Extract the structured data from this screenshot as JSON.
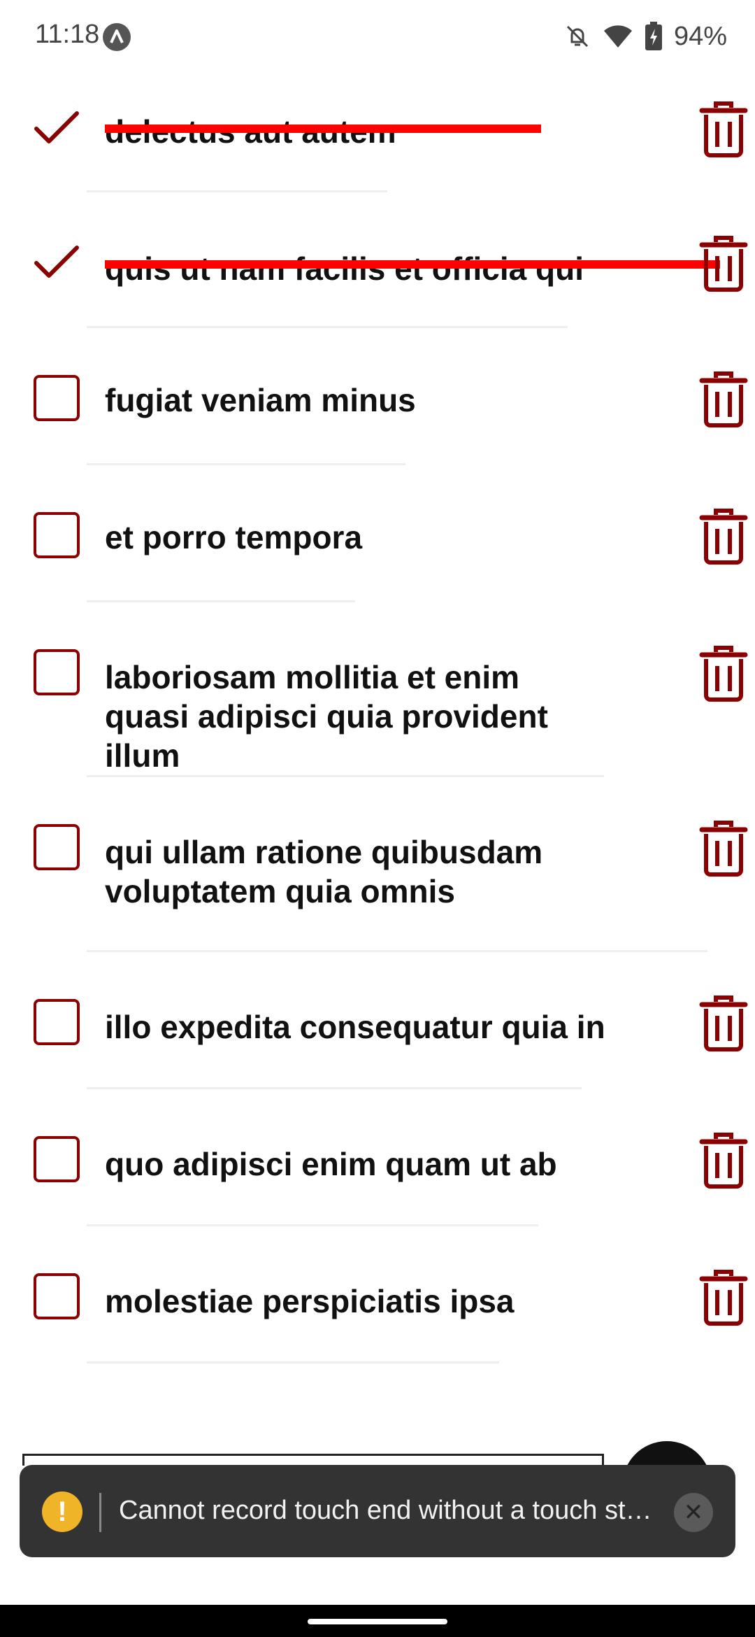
{
  "status": {
    "time": "11:18",
    "battery": "94%",
    "icons": [
      "app-icon",
      "notifications-off-icon",
      "wifi-icon",
      "battery-charging-icon"
    ]
  },
  "colors": {
    "accent": "#8b0000",
    "strike": "#ff0000",
    "toast_bg": "#333333",
    "warning": "#f0b429"
  },
  "todos": [
    {
      "label": "delectus aut autem",
      "done": true
    },
    {
      "label": "quis ut nam facilis et officia qui",
      "done": true
    },
    {
      "label": "fugiat veniam minus",
      "done": false
    },
    {
      "label": "et porro tempora",
      "done": false
    },
    {
      "label": "laboriosam mollitia et enim quasi adipisci quia provident illum",
      "done": false
    },
    {
      "label": "qui ullam ratione quibusdam voluptatem quia omnis",
      "done": false
    },
    {
      "label": "illo expedita consequatur quia in",
      "done": false
    },
    {
      "label": "quo adipisci enim quam ut ab",
      "done": false
    },
    {
      "label": "molestiae perspiciatis ipsa",
      "done": false
    }
  ],
  "toast": {
    "message": "Cannot record touch end without a touch st…",
    "icon": "warning-icon",
    "close_icon": "close-icon"
  }
}
